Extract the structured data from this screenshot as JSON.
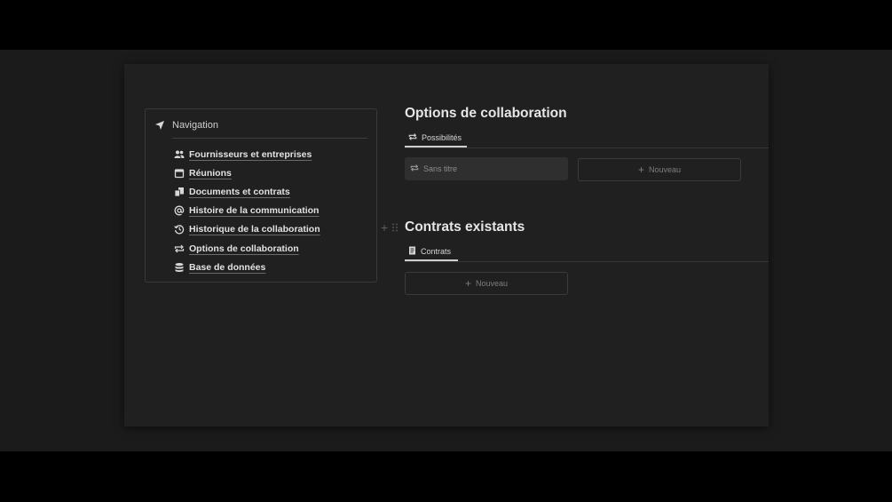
{
  "navigation": {
    "title": "Navigation",
    "icon": "navigation-arrow-icon",
    "items": [
      {
        "label": "Fournisseurs et entreprises",
        "icon": "people-icon"
      },
      {
        "label": "Réunions",
        "icon": "calendar-icon"
      },
      {
        "label": "Documents et contrats",
        "icon": "documents-icon"
      },
      {
        "label": "Histoire de la communication",
        "icon": "at-sign-icon"
      },
      {
        "label": "Historique de la collaboration",
        "icon": "history-icon"
      },
      {
        "label": "Options de collaboration",
        "icon": "repeat-icon"
      },
      {
        "label": "Base de données",
        "icon": "database-icon"
      }
    ]
  },
  "collaboration": {
    "title": "Options de collaboration",
    "tab_label": "Possibilités",
    "card_label": "Sans titre",
    "new_label": "Nouveau"
  },
  "contracts": {
    "title": "Contrats existants",
    "tab_label": "Contrats",
    "new_label": "Nouveau"
  },
  "colors": {
    "background": "#000000",
    "page": "#202020",
    "text": "#e2e2e2",
    "muted": "#7d7d7d"
  }
}
